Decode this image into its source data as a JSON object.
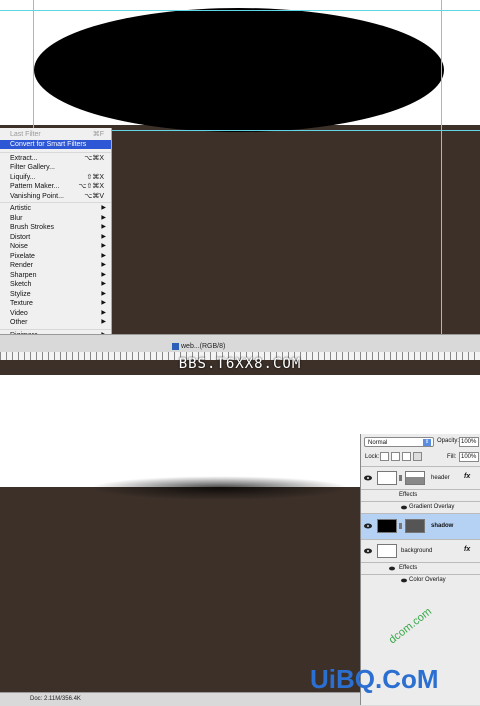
{
  "filter_menu": {
    "items": [
      {
        "label": "Last Filter",
        "shortcut": "⌘F",
        "disabled": true
      },
      {
        "label": "Convert for Smart Filters",
        "shortcut": "",
        "selected": true
      },
      {
        "label": "Extract...",
        "shortcut": "⌥⌘X"
      },
      {
        "label": "Filter Gallery...",
        "shortcut": ""
      },
      {
        "label": "Liquify...",
        "shortcut": "⇧⌘X"
      },
      {
        "label": "Pattern Maker...",
        "shortcut": "⌥⇧⌘X"
      },
      {
        "label": "Vanishing Point...",
        "shortcut": "⌥⌘V"
      },
      {
        "label": "Artistic",
        "submenu": true
      },
      {
        "label": "Blur",
        "submenu": true
      },
      {
        "label": "Brush Strokes",
        "submenu": true
      },
      {
        "label": "Distort",
        "submenu": true
      },
      {
        "label": "Noise",
        "submenu": true
      },
      {
        "label": "Pixelate",
        "submenu": true
      },
      {
        "label": "Render",
        "submenu": true
      },
      {
        "label": "Sharpen",
        "submenu": true
      },
      {
        "label": "Sketch",
        "submenu": true
      },
      {
        "label": "Stylize",
        "submenu": true
      },
      {
        "label": "Texture",
        "submenu": true
      },
      {
        "label": "Video",
        "submenu": true
      },
      {
        "label": "Other",
        "submenu": true
      },
      {
        "label": "Digimarc",
        "submenu": true
      }
    ],
    "submenu_arrow": "▶"
  },
  "document": {
    "tab_label": "web...(RGB/8)",
    "status_bottom": "Doc: 2.11M/356.4K"
  },
  "watermarks": {
    "top": "BBS.T6XX8.COM",
    "bottom": "UiBQ.CoM",
    "diagonal": "dcom.com"
  },
  "layers_panel": {
    "blend_mode": "Normal",
    "opacity_label": "Opacity:",
    "opacity_value": "100%",
    "lock_label": "Lock:",
    "fill_label": "Fill:",
    "fill_value": "100%",
    "fx_label": "fx",
    "layers": [
      {
        "name": "header",
        "effects_label": "Effects",
        "effects": [
          "Gradient Overlay"
        ],
        "selected": false
      },
      {
        "name": "shadow",
        "selected": true
      },
      {
        "name": "background",
        "effects_label": "Effects",
        "effects": [
          "Color Overlay"
        ],
        "selected": false
      }
    ]
  }
}
